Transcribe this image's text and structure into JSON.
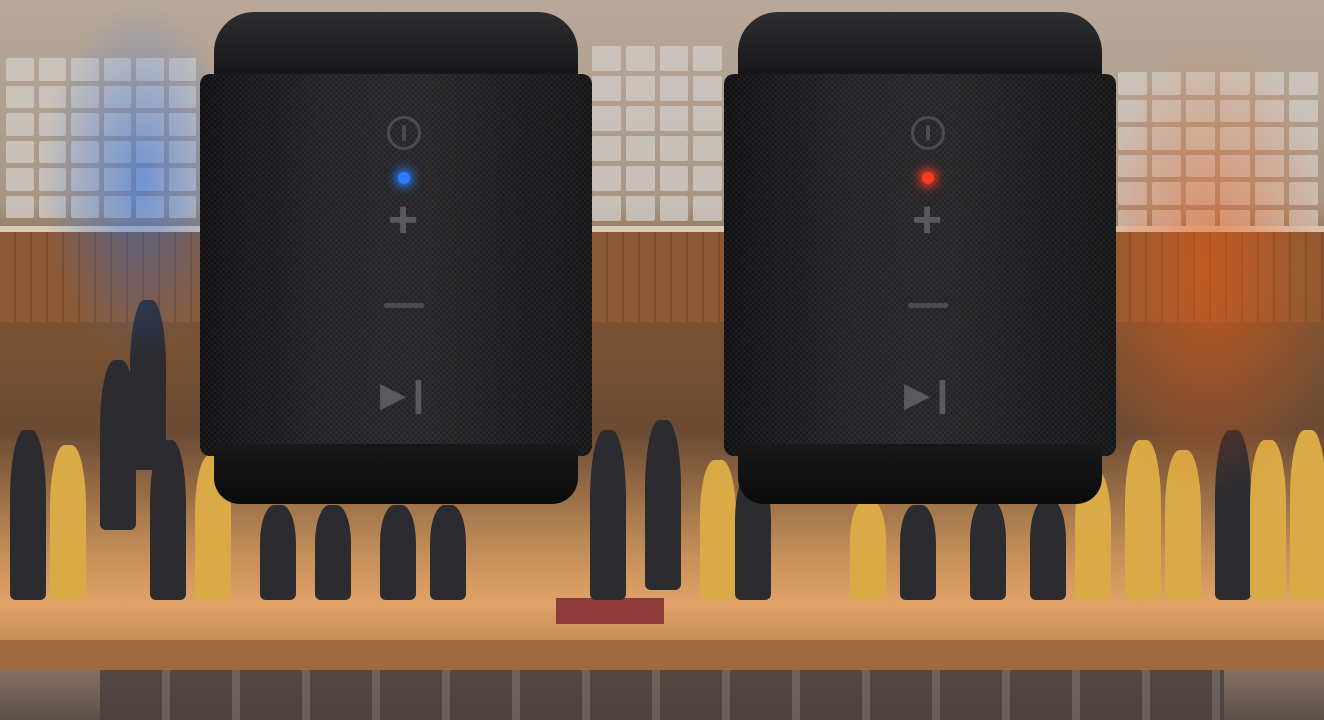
{
  "scene": {
    "description_icon": "photo-concert-hall-with-two-speakers"
  },
  "speakers": [
    {
      "led_color": "#2f7bff",
      "icons": [
        "power-icon",
        "volume-up-icon",
        "volume-down-icon",
        "play-pause-icon"
      ]
    },
    {
      "led_color": "#ff3b1f",
      "icons": [
        "power-icon",
        "volume-up-icon",
        "volume-down-icon",
        "play-pause-icon"
      ]
    }
  ],
  "colors": {
    "stage_wood": "#d9a06a",
    "speaker_body": "#1c1c1f",
    "blue_glow": "#286ee6",
    "orange_glow": "#f05a14"
  }
}
